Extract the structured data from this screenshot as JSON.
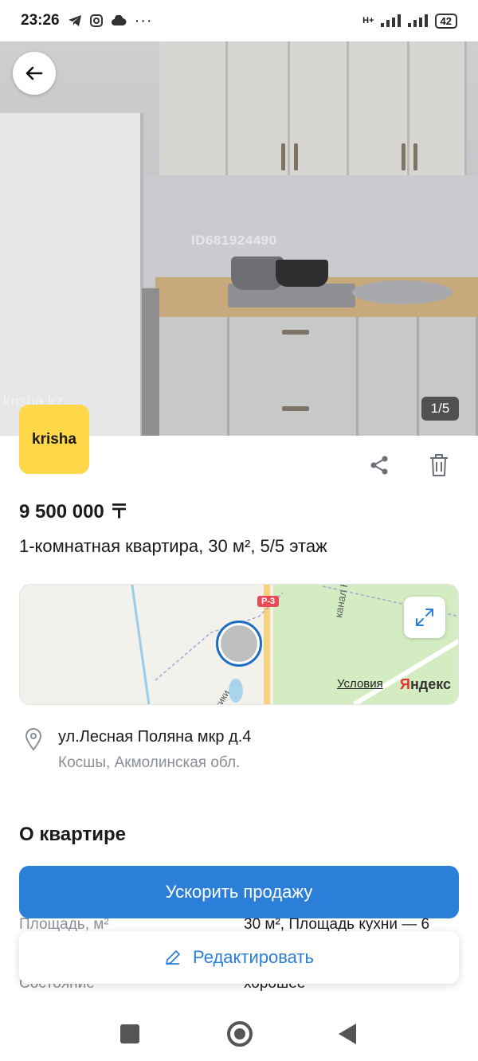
{
  "status_bar": {
    "time": "23:26",
    "network": "H+",
    "battery": "42"
  },
  "gallery": {
    "counter": "1/5",
    "watermark_id": "ID681924490",
    "watermark_site": "krisha.kz"
  },
  "brand": {
    "logo_text": "krisha",
    "logo_color": "#ffd84a"
  },
  "listing": {
    "price": "9 500 000 〒",
    "title": "1-комнатная квартира, 30 м², 5/5 этаж"
  },
  "map": {
    "road_label": "Р-3",
    "canal_label": "канал Нура-Иш",
    "street_label": "блики",
    "terms_link": "Условия",
    "provider_first": "Я",
    "provider_rest": "ндекс"
  },
  "address": {
    "street": "ул.Лесная Поляна мкр д.4",
    "city": "Косшы, Акмолинская обл."
  },
  "details": {
    "section_title": "О квартире",
    "rows": [
      {
        "label": "Площадь, м²",
        "value": "30 м², Площадь кухни — 6"
      },
      {
        "label": "Состояние",
        "value": "хорошее"
      }
    ]
  },
  "actions": {
    "boost_label": "Ускорить продажу",
    "edit_label": "Редактировать"
  },
  "colors": {
    "accent": "#2b7fd9",
    "road_badge": "#e84b55"
  }
}
